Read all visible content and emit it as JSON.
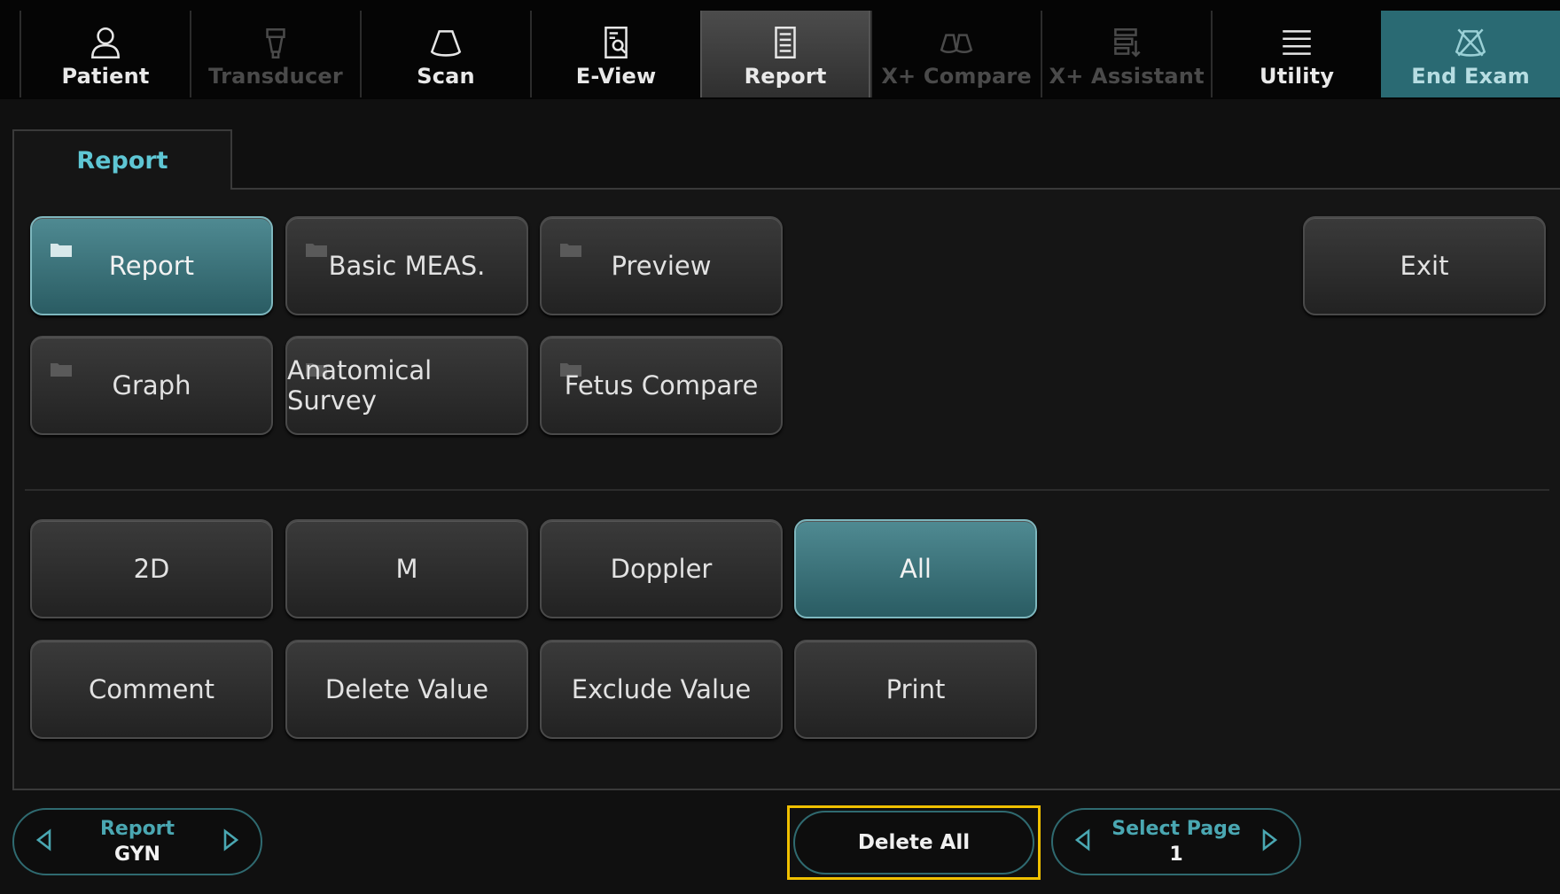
{
  "toolbar": {
    "items": [
      {
        "label": "Patient",
        "icon": "person-icon",
        "state": "normal"
      },
      {
        "label": "Transducer",
        "icon": "transducer-icon",
        "state": "disabled"
      },
      {
        "label": "Scan",
        "icon": "scan-icon",
        "state": "normal"
      },
      {
        "label": "E-View",
        "icon": "document-search-icon",
        "state": "normal"
      },
      {
        "label": "Report",
        "icon": "report-icon",
        "state": "selected"
      },
      {
        "label": "X+ Compare",
        "icon": "compare-icon",
        "state": "disabled"
      },
      {
        "label": "X+ Assistant",
        "icon": "assistant-icon",
        "state": "disabled"
      },
      {
        "label": "Utility",
        "icon": "menu-icon",
        "state": "normal"
      },
      {
        "label": "End Exam",
        "icon": "end-exam-icon",
        "state": "end"
      }
    ]
  },
  "tab": {
    "label": "Report"
  },
  "buttons": {
    "report": "Report",
    "basic_meas": "Basic MEAS.",
    "preview": "Preview",
    "exit": "Exit",
    "graph": "Graph",
    "anatomical_survey": "Anatomical Survey",
    "fetus_compare": "Fetus Compare",
    "mode_2d": "2D",
    "mode_m": "M",
    "doppler": "Doppler",
    "all": "All",
    "comment": "Comment",
    "delete_value": "Delete Value",
    "exclude_value": "Exclude Value",
    "print": "Print"
  },
  "bottom": {
    "report_selector": {
      "title": "Report",
      "value": "GYN"
    },
    "delete_all": "Delete All",
    "page_selector": {
      "title": "Select Page",
      "value": "1"
    }
  },
  "colors": {
    "accent": "#5ec6d4",
    "active_button": "#2a6a73",
    "highlight_border": "#f0c000"
  }
}
